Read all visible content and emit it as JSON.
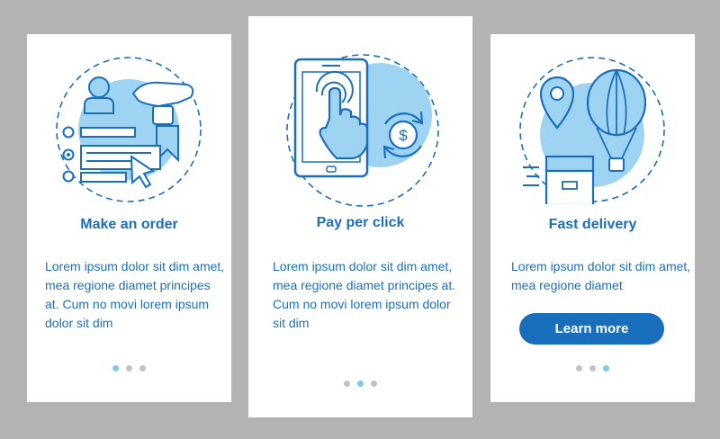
{
  "colors": {
    "accent": "#1a6fbd",
    "light_blue": "#9fd3f2",
    "background": "#b3b3b3",
    "dot_active": "#7ec8ee",
    "dot_inactive": "#c2c2c2"
  },
  "screens": [
    {
      "title": "Make an order",
      "body": "Lorem ipsum dolor sit dim amet, mea regione diamet principes at. Cum no movi lorem ipsum dolor sit dim",
      "icons": [
        "user-icon",
        "hand-card-icon",
        "bookmark-icon",
        "order-form-icon",
        "cursor-icon"
      ],
      "dots": {
        "count": 3,
        "active": 1
      }
    },
    {
      "title": "Pay per click",
      "body": "Lorem ipsum dolor sit dim amet, mea regione diamet principes at. Cum no movi lorem ipsum dolor sit dim",
      "icons": [
        "smartphone-icon",
        "tap-hand-icon",
        "dollar-coin-icon",
        "refresh-arrows-icon"
      ],
      "dots": {
        "count": 3,
        "active": 2
      }
    },
    {
      "title": "Fast delivery",
      "body": "Lorem ipsum dolor sit dim amet, mea regione diamet",
      "button": "Learn more",
      "icons": [
        "location-pin-icon",
        "hot-air-balloon-icon",
        "parcel-box-icon"
      ],
      "dots": {
        "count": 3,
        "active": 3
      }
    }
  ]
}
